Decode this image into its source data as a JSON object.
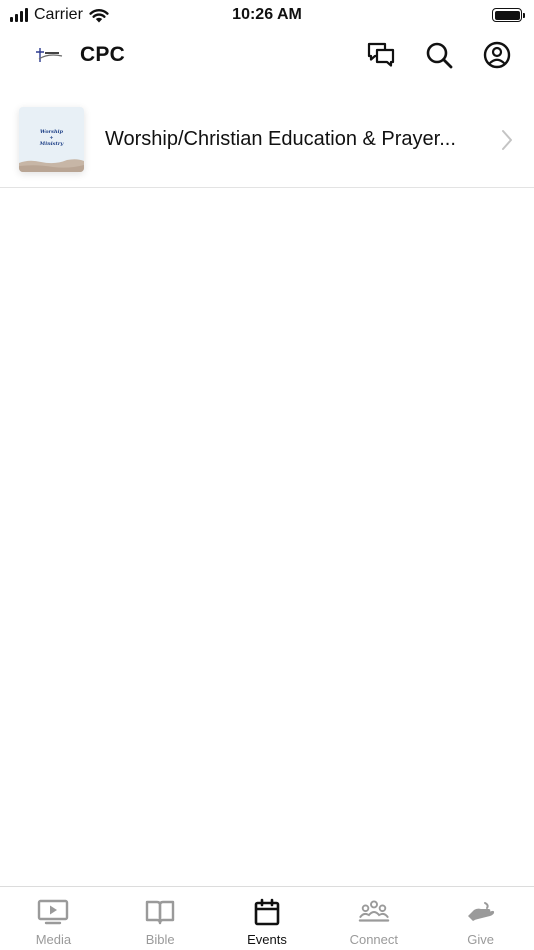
{
  "status_bar": {
    "carrier": "Carrier",
    "time": "10:26 AM"
  },
  "header": {
    "brand": "CPC",
    "icons": [
      "brand-logo-icon",
      "chat-icon",
      "search-icon",
      "profile-icon"
    ]
  },
  "events": [
    {
      "title": "Worship/Christian Education & Prayer...",
      "thumbnail_text": [
        "Worship",
        "+",
        "Ministry"
      ]
    }
  ],
  "tabs": [
    {
      "label": "Media",
      "icon": "media-icon",
      "active": false
    },
    {
      "label": "Bible",
      "icon": "bible-icon",
      "active": false
    },
    {
      "label": "Events",
      "icon": "calendar-icon",
      "active": true
    },
    {
      "label": "Connect",
      "icon": "people-icon",
      "active": false
    },
    {
      "label": "Give",
      "icon": "give-hand-icon",
      "active": false
    }
  ],
  "colors": {
    "text": "#111111",
    "inactive_tab": "#9a9a9a",
    "divider": "#e3e3e3"
  }
}
